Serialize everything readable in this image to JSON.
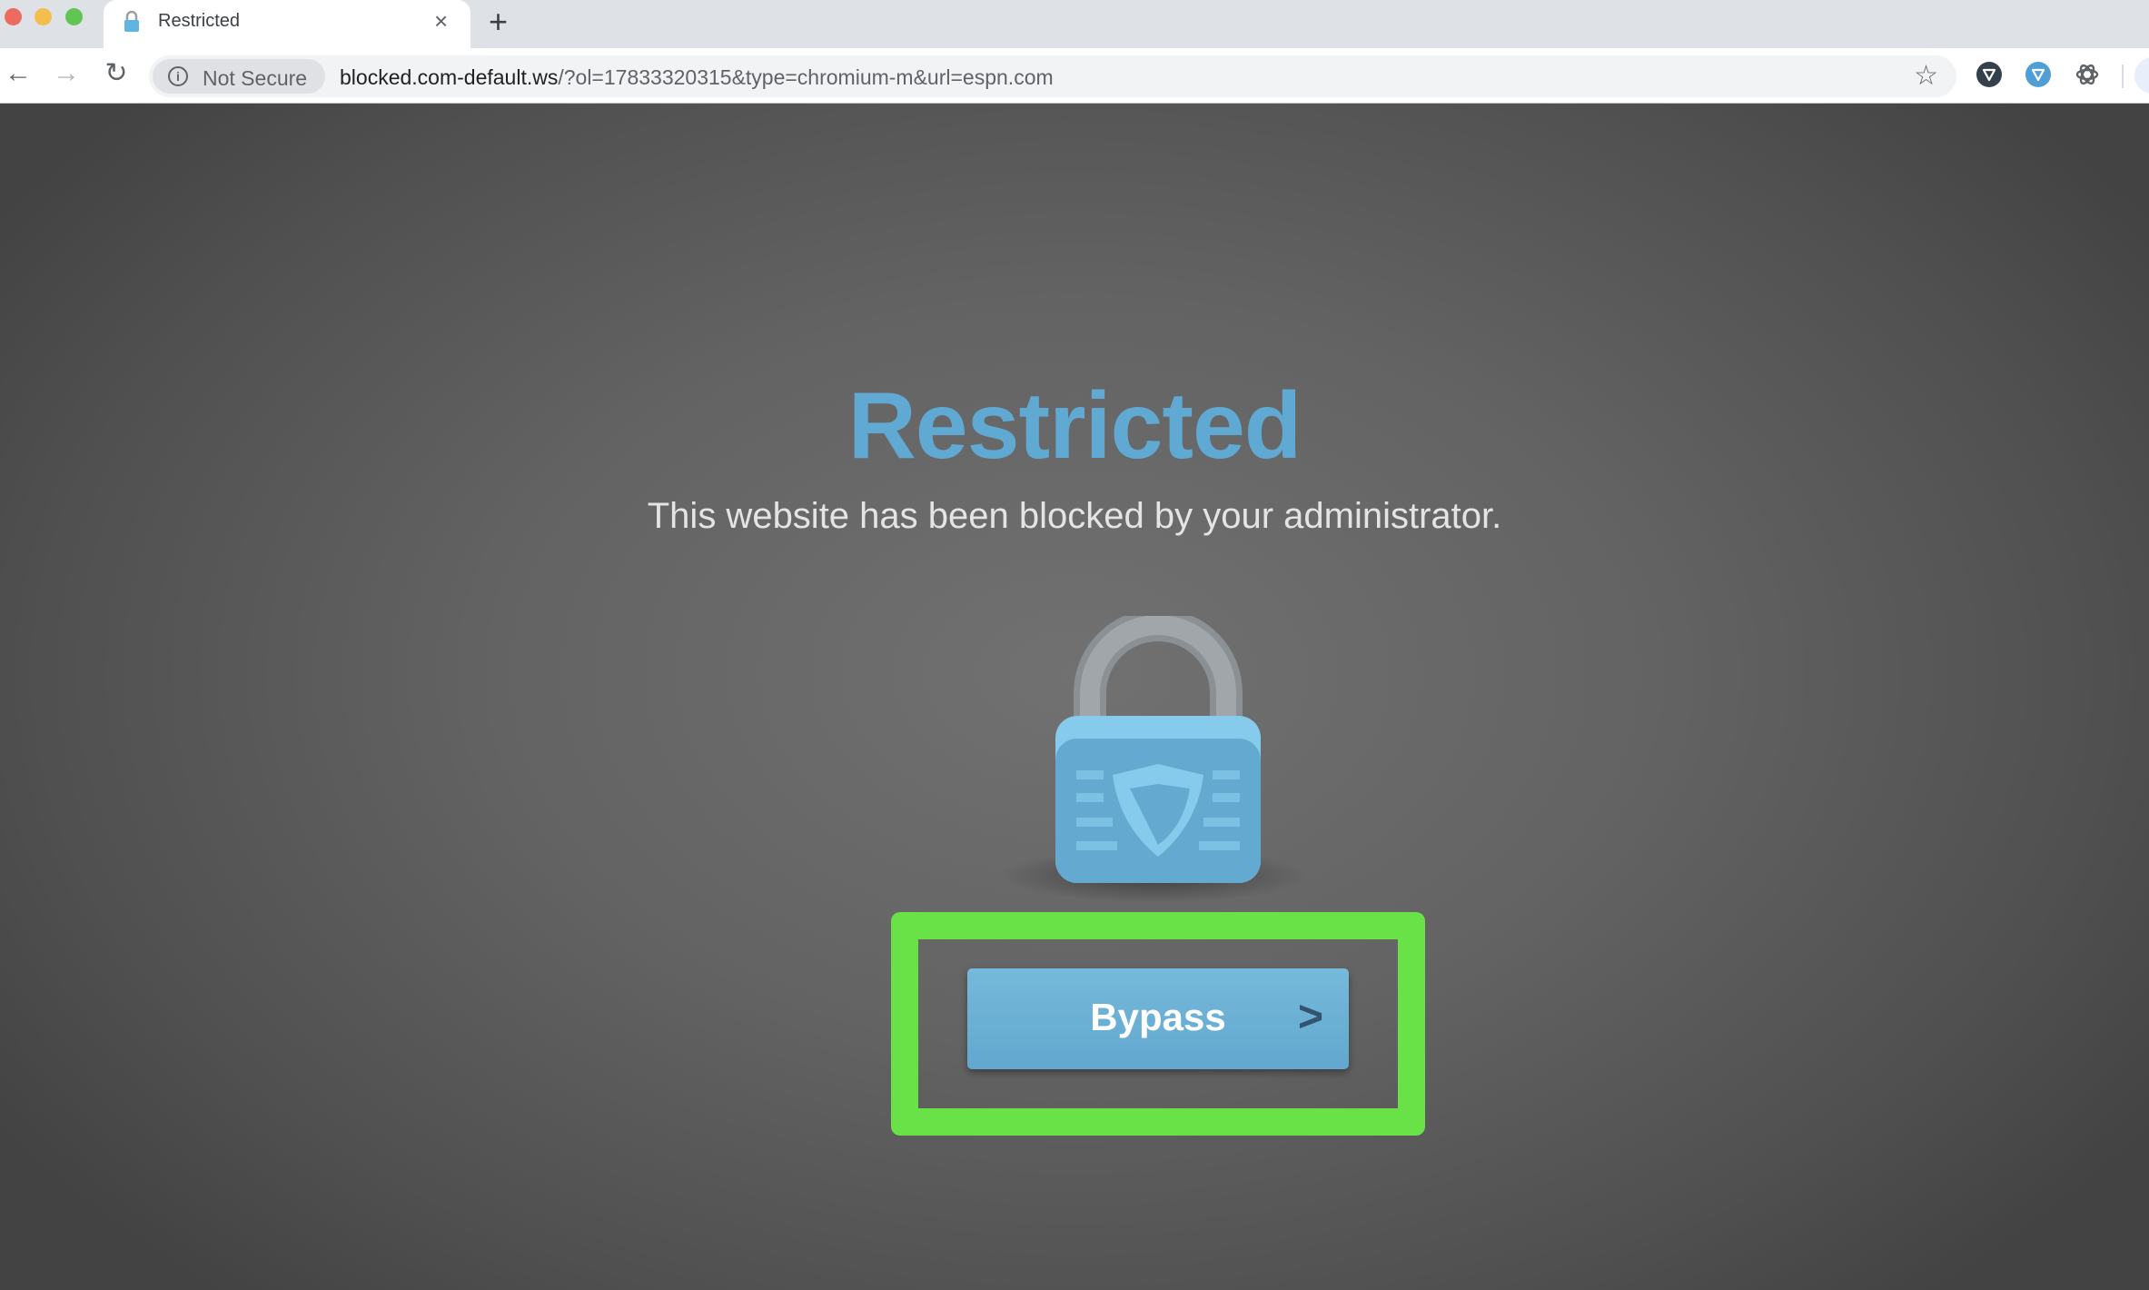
{
  "browser": {
    "tab": {
      "title": "Restricted",
      "close_icon": "close-icon",
      "favicon": "lock-icon"
    },
    "new_tab_label": "+",
    "toolbar": {
      "back_icon": "arrow-left-icon",
      "forward_icon": "arrow-right-icon",
      "reload_icon": "reload-icon",
      "security_chip": {
        "icon": "info-icon",
        "label": "Not Secure"
      },
      "url_host": "blocked.com-default.ws",
      "url_rest": "/?ol=17833320315&type=chromium-m&url=espn.com",
      "bookmark_icon": "star-icon",
      "extensions": [
        "shield-extension-dark-icon",
        "shield-extension-blue-icon",
        "openai-extension-icon"
      ],
      "profile_icon": "profile-avatar"
    }
  },
  "page": {
    "title": "Restricted",
    "subtitle": "This website has been blocked by your administrator.",
    "lock_icon": "padlock-shield-icon",
    "bypass_button": {
      "label": "Bypass",
      "chevron": ">"
    },
    "colors": {
      "title": "#5fa9d3",
      "button": "#6aafd4",
      "highlight": "#69e247"
    }
  }
}
